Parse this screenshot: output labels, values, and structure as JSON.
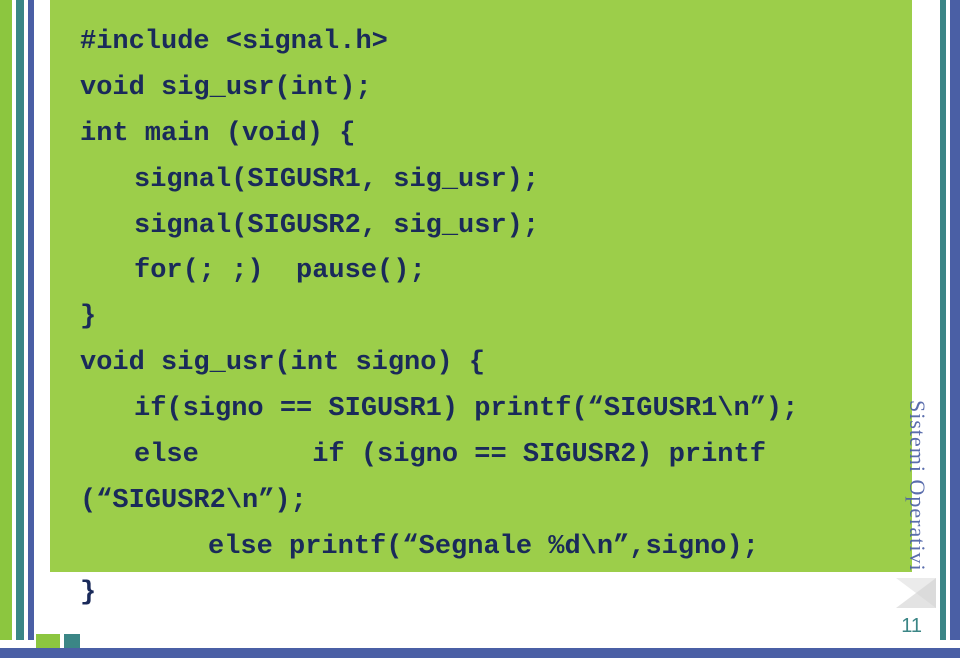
{
  "code": {
    "l1": "#include <signal.h>",
    "l2": "void sig_usr(int);",
    "l3": "int main (void) {",
    "l4": "signal(SIGUSR1, sig_usr);",
    "l5": "signal(SIGUSR2, sig_usr);",
    "l6": "for(; ;)  pause();",
    "l7": "}",
    "l8": "void sig_usr(int signo) {",
    "l9": "if(signo == SIGUSR1) printf(“SIGUSR1\\n”);",
    "l10a": "else",
    "l10b": "if (signo == SIGUSR2) printf",
    "l11": "(“SIGUSR2\\n”);",
    "l12": "else printf(“Segnale %d\\n”,signo);",
    "l13": "}"
  },
  "sidebar": {
    "label": "Sistemi Operativi"
  },
  "footer": {
    "page_number": "11"
  }
}
